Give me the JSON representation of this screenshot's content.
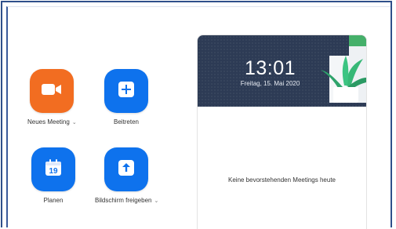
{
  "actions": {
    "new_meeting": {
      "label": "Neues Meeting",
      "icon": "video-camera-icon",
      "color": "#f26d21"
    },
    "join": {
      "label": "Beitreten",
      "icon": "plus-icon",
      "color": "#0e72ed"
    },
    "schedule": {
      "label": "Planen",
      "icon": "calendar-icon",
      "day": "19",
      "color": "#0e72ed"
    },
    "share_screen": {
      "label": "Bildschirm freigeben",
      "icon": "upload-arrow-icon",
      "color": "#0e72ed"
    }
  },
  "panel": {
    "time": "13:01",
    "date": "Freitag, 15. Mai 2020",
    "empty_text": "Keine bevorstehenden Meetings heute"
  }
}
